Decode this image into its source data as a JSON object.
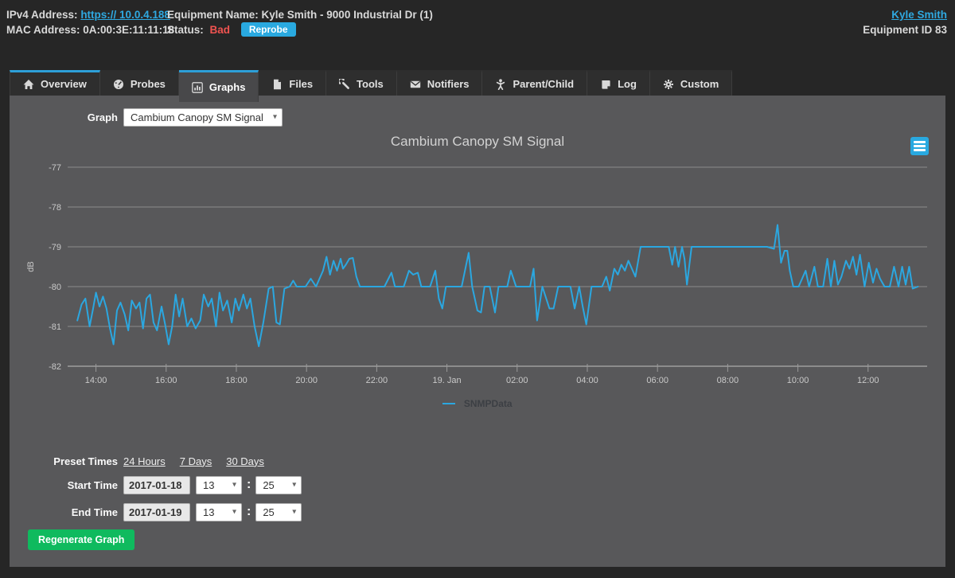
{
  "header": {
    "ipv4_label": "IPv4 Address:",
    "ipv4_value": "https:// 10.0.4.188",
    "mac_label": "MAC Address:",
    "mac_value": "0A:00:3E:11:11:18",
    "equipment_label": "Equipment Name:",
    "equipment_value": "Kyle Smith - 9000 Industrial Dr (1)",
    "status_label": "Status:",
    "status_value": "Bad",
    "reprobe_label": "Reprobe",
    "user_link": "Kyle Smith",
    "equipment_id": "Equipment ID 83"
  },
  "tabs": [
    {
      "label": "Overview",
      "icon": "home-icon",
      "active": false
    },
    {
      "label": "Probes",
      "icon": "gauge-icon",
      "active": false
    },
    {
      "label": "Graphs",
      "icon": "bar-chart-icon",
      "active": true
    },
    {
      "label": "Files",
      "icon": "file-icon",
      "active": false
    },
    {
      "label": "Tools",
      "icon": "wrench-icon",
      "active": false
    },
    {
      "label": "Notifiers",
      "icon": "envelope-icon",
      "active": false
    },
    {
      "label": "Parent/Child",
      "icon": "person-icon",
      "active": false
    },
    {
      "label": "Log",
      "icon": "note-icon",
      "active": false
    },
    {
      "label": "Custom",
      "icon": "gear-icon",
      "active": false
    }
  ],
  "graph_selector": {
    "label": "Graph",
    "selected": "Cambium Canopy SM Signal"
  },
  "chart_data": {
    "type": "line",
    "title": "Cambium Canopy SM Signal",
    "ylabel": "dB",
    "ylim": [
      -82,
      -77
    ],
    "yticks": [
      -77,
      -78,
      -79,
      -80,
      -81,
      -82
    ],
    "x_unit": "hours elapsed since 2017-01-18 13:25",
    "x_range": [
      0,
      24
    ],
    "grid": "horizontal",
    "legend_position": "bottom",
    "xticks": [
      {
        "label": "14:00",
        "h": 0.58
      },
      {
        "label": "16:00",
        "h": 2.58
      },
      {
        "label": "18:00",
        "h": 4.58
      },
      {
        "label": "20:00",
        "h": 6.58
      },
      {
        "label": "22:00",
        "h": 8.58
      },
      {
        "label": "19. Jan",
        "h": 10.58
      },
      {
        "label": "02:00",
        "h": 12.58
      },
      {
        "label": "04:00",
        "h": 14.58
      },
      {
        "label": "06:00",
        "h": 16.58
      },
      {
        "label": "08:00",
        "h": 18.58
      },
      {
        "label": "10:00",
        "h": 20.58
      },
      {
        "label": "12:00",
        "h": 22.58
      }
    ],
    "series": [
      {
        "name": "SNMPData",
        "color": "#2ba7e0",
        "points": [
          [
            0.05,
            -80.85
          ],
          [
            0.17,
            -80.45
          ],
          [
            0.28,
            -80.3
          ],
          [
            0.4,
            -81.0
          ],
          [
            0.5,
            -80.55
          ],
          [
            0.58,
            -80.15
          ],
          [
            0.68,
            -80.5
          ],
          [
            0.78,
            -80.25
          ],
          [
            0.88,
            -80.55
          ],
          [
            0.98,
            -81.05
          ],
          [
            1.08,
            -81.45
          ],
          [
            1.18,
            -80.6
          ],
          [
            1.28,
            -80.4
          ],
          [
            1.4,
            -80.7
          ],
          [
            1.5,
            -81.1
          ],
          [
            1.6,
            -80.35
          ],
          [
            1.72,
            -80.55
          ],
          [
            1.82,
            -80.4
          ],
          [
            1.92,
            -81.05
          ],
          [
            2.02,
            -80.3
          ],
          [
            2.12,
            -80.2
          ],
          [
            2.22,
            -80.9
          ],
          [
            2.32,
            -81.1
          ],
          [
            2.45,
            -80.5
          ],
          [
            2.55,
            -80.95
          ],
          [
            2.65,
            -81.45
          ],
          [
            2.75,
            -81.0
          ],
          [
            2.85,
            -80.2
          ],
          [
            2.95,
            -80.75
          ],
          [
            3.05,
            -80.3
          ],
          [
            3.18,
            -81.0
          ],
          [
            3.3,
            -80.8
          ],
          [
            3.42,
            -81.05
          ],
          [
            3.55,
            -80.85
          ],
          [
            3.65,
            -80.2
          ],
          [
            3.78,
            -80.5
          ],
          [
            3.88,
            -80.3
          ],
          [
            4.0,
            -81.0
          ],
          [
            4.1,
            -80.15
          ],
          [
            4.2,
            -80.6
          ],
          [
            4.32,
            -80.35
          ],
          [
            4.45,
            -80.9
          ],
          [
            4.55,
            -80.3
          ],
          [
            4.65,
            -80.6
          ],
          [
            4.78,
            -80.2
          ],
          [
            4.88,
            -80.55
          ],
          [
            4.98,
            -80.3
          ],
          [
            5.1,
            -81.0
          ],
          [
            5.22,
            -81.5
          ],
          [
            5.35,
            -80.9
          ],
          [
            5.5,
            -80.05
          ],
          [
            5.62,
            -80.0
          ],
          [
            5.72,
            -80.9
          ],
          [
            5.82,
            -80.95
          ],
          [
            5.95,
            -80.05
          ],
          [
            6.1,
            -80.0
          ],
          [
            6.2,
            -79.85
          ],
          [
            6.3,
            -80.0
          ],
          [
            6.55,
            -80.0
          ],
          [
            6.7,
            -79.8
          ],
          [
            6.85,
            -80.0
          ],
          [
            7.05,
            -79.6
          ],
          [
            7.15,
            -79.25
          ],
          [
            7.25,
            -79.7
          ],
          [
            7.35,
            -79.35
          ],
          [
            7.45,
            -79.6
          ],
          [
            7.55,
            -79.3
          ],
          [
            7.62,
            -79.55
          ],
          [
            7.7,
            -79.45
          ],
          [
            7.8,
            -79.3
          ],
          [
            7.9,
            -79.28
          ],
          [
            8.0,
            -79.75
          ],
          [
            8.1,
            -80.0
          ],
          [
            8.3,
            -80.0
          ],
          [
            8.55,
            -80.0
          ],
          [
            8.8,
            -80.0
          ],
          [
            9.0,
            -79.65
          ],
          [
            9.1,
            -80.0
          ],
          [
            9.35,
            -80.0
          ],
          [
            9.5,
            -79.6
          ],
          [
            9.62,
            -79.7
          ],
          [
            9.75,
            -79.65
          ],
          [
            9.85,
            -80.0
          ],
          [
            10.1,
            -80.0
          ],
          [
            10.25,
            -79.6
          ],
          [
            10.35,
            -80.3
          ],
          [
            10.45,
            -80.55
          ],
          [
            10.55,
            -80.0
          ],
          [
            10.8,
            -80.0
          ],
          [
            11.0,
            -80.0
          ],
          [
            11.2,
            -79.15
          ],
          [
            11.3,
            -80.0
          ],
          [
            11.45,
            -80.6
          ],
          [
            11.55,
            -80.65
          ],
          [
            11.65,
            -80.0
          ],
          [
            11.8,
            -80.0
          ],
          [
            11.95,
            -80.65
          ],
          [
            12.05,
            -80.0
          ],
          [
            12.3,
            -80.0
          ],
          [
            12.4,
            -79.6
          ],
          [
            12.55,
            -80.0
          ],
          [
            12.95,
            -80.0
          ],
          [
            13.05,
            -79.55
          ],
          [
            13.15,
            -80.85
          ],
          [
            13.3,
            -80.0
          ],
          [
            13.5,
            -80.55
          ],
          [
            13.62,
            -80.55
          ],
          [
            13.75,
            -80.0
          ],
          [
            14.1,
            -80.0
          ],
          [
            14.22,
            -80.55
          ],
          [
            14.35,
            -80.0
          ],
          [
            14.45,
            -80.5
          ],
          [
            14.55,
            -80.95
          ],
          [
            14.7,
            -80.0
          ],
          [
            15.0,
            -80.0
          ],
          [
            15.12,
            -79.75
          ],
          [
            15.22,
            -80.1
          ],
          [
            15.35,
            -79.55
          ],
          [
            15.45,
            -79.7
          ],
          [
            15.55,
            -79.45
          ],
          [
            15.65,
            -79.6
          ],
          [
            15.75,
            -79.35
          ],
          [
            15.85,
            -79.55
          ],
          [
            15.95,
            -79.75
          ],
          [
            16.1,
            -79.0
          ],
          [
            16.5,
            -79.0
          ],
          [
            16.9,
            -79.0
          ],
          [
            17.0,
            -79.45
          ],
          [
            17.08,
            -79.0
          ],
          [
            17.18,
            -79.5
          ],
          [
            17.28,
            -79.0
          ],
          [
            17.35,
            -79.3
          ],
          [
            17.42,
            -79.95
          ],
          [
            17.55,
            -79.0
          ],
          [
            17.8,
            -79.0
          ],
          [
            18.2,
            -79.0
          ],
          [
            18.6,
            -79.0
          ],
          [
            19.0,
            -79.0
          ],
          [
            19.4,
            -79.0
          ],
          [
            19.7,
            -79.0
          ],
          [
            19.9,
            -79.05
          ],
          [
            20.0,
            -78.45
          ],
          [
            20.1,
            -79.4
          ],
          [
            20.2,
            -79.1
          ],
          [
            20.28,
            -79.1
          ],
          [
            20.35,
            -79.6
          ],
          [
            20.45,
            -80.0
          ],
          [
            20.6,
            -80.0
          ],
          [
            20.8,
            -79.6
          ],
          [
            20.9,
            -80.0
          ],
          [
            21.05,
            -79.5
          ],
          [
            21.15,
            -80.0
          ],
          [
            21.3,
            -80.0
          ],
          [
            21.42,
            -79.3
          ],
          [
            21.52,
            -80.0
          ],
          [
            21.62,
            -79.35
          ],
          [
            21.72,
            -79.95
          ],
          [
            21.82,
            -79.75
          ],
          [
            21.95,
            -79.35
          ],
          [
            22.05,
            -79.55
          ],
          [
            22.15,
            -79.25
          ],
          [
            22.25,
            -79.7
          ],
          [
            22.35,
            -79.2
          ],
          [
            22.48,
            -80.0
          ],
          [
            22.6,
            -79.4
          ],
          [
            22.72,
            -79.9
          ],
          [
            22.82,
            -79.55
          ],
          [
            22.92,
            -79.8
          ],
          [
            23.05,
            -80.0
          ],
          [
            23.2,
            -80.0
          ],
          [
            23.32,
            -79.5
          ],
          [
            23.45,
            -80.0
          ],
          [
            23.55,
            -79.5
          ],
          [
            23.65,
            -79.95
          ],
          [
            23.75,
            -79.5
          ],
          [
            23.85,
            -80.05
          ],
          [
            24.0,
            -80.0
          ]
        ]
      }
    ]
  },
  "form": {
    "preset_label": "Preset Times",
    "presets": [
      "24 Hours",
      "7 Days",
      "30 Days"
    ],
    "start_label": "Start Time",
    "start_date": "2017-01-18",
    "start_hour": "13",
    "start_minute": "25",
    "end_label": "End Time",
    "end_date": "2017-01-19",
    "end_hour": "13",
    "end_minute": "25",
    "time_separator": ":",
    "regenerate_label": "Regenerate Graph"
  },
  "colors": {
    "accent_blue": "#29a9e0",
    "line_blue": "#2ba7e0",
    "status_red": "#ef5350",
    "button_green": "#0fba5e",
    "panel_gray": "#58585a",
    "background": "#262626"
  }
}
